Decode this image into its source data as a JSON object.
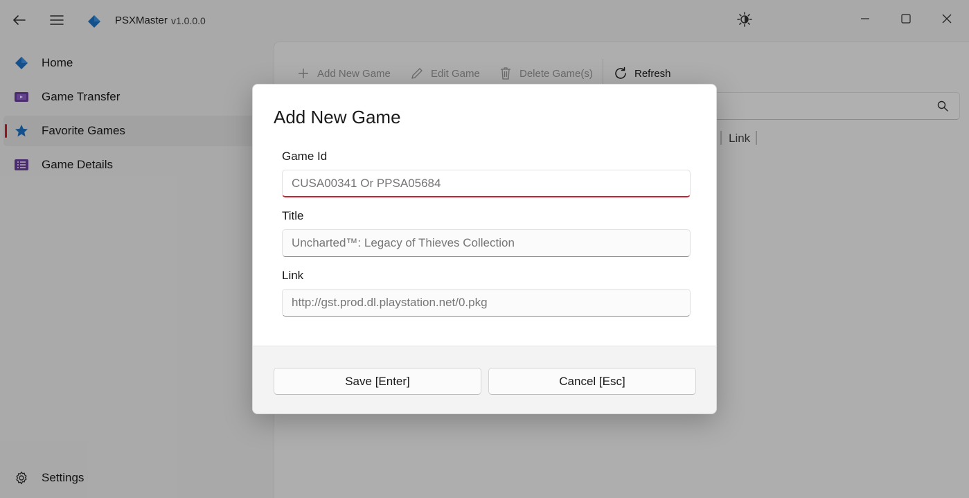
{
  "app": {
    "title": "PSXMaster",
    "version": "v1.0.0.0"
  },
  "icons": {
    "back": "back-arrow-icon",
    "menu": "hamburger-menu-icon",
    "logo": "diamond-logo-icon",
    "theme": "brightness-icon",
    "minimize": "minimize-icon",
    "maximize": "maximize-icon",
    "close": "close-icon",
    "search": "search-icon"
  },
  "colors": {
    "accent": "#d21f2d",
    "logo_blue": "#1e73c8",
    "purple": "#6b3fa0"
  },
  "sidebar": {
    "items": [
      {
        "label": "Home",
        "icon": "diamond-icon"
      },
      {
        "label": "Game Transfer",
        "icon": "transfer-icon"
      },
      {
        "label": "Favorite Games",
        "icon": "star-icon",
        "selected": true
      },
      {
        "label": "Game Details",
        "icon": "details-list-icon"
      }
    ],
    "footer": {
      "label": "Settings",
      "icon": "gear-icon"
    }
  },
  "toolbar": {
    "add_label": "Add New Game",
    "edit_label": "Edit Game",
    "delete_label": "Delete Game(s)",
    "refresh_label": "Refresh"
  },
  "table": {
    "visible_columns": [
      "Link"
    ]
  },
  "dialog": {
    "title": "Add New Game",
    "fields": {
      "game_id": {
        "label": "Game Id",
        "value": "",
        "placeholder": "CUSA00341 Or PPSA05684"
      },
      "title": {
        "label": "Title",
        "value": "",
        "placeholder": "Uncharted™: Legacy of Thieves Collection"
      },
      "link": {
        "label": "Link",
        "value": "",
        "placeholder": "http://gst.prod.dl.playstation.net/0.pkg"
      }
    },
    "save_label": "Save [Enter]",
    "cancel_label": "Cancel [Esc]"
  }
}
